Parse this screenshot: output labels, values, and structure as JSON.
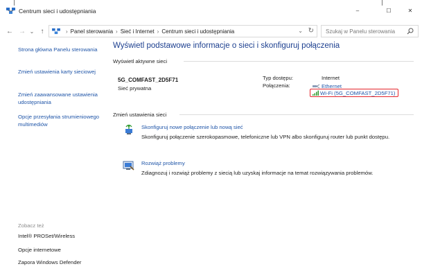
{
  "window": {
    "title": "Centrum sieci i udostępniania",
    "controls": {
      "minimize": "–",
      "maximize": "☐",
      "close": "✕"
    }
  },
  "nav": {
    "back": "←",
    "forward": "→",
    "recent": "⌄",
    "up": "↑",
    "breadcrumbs": [
      "Panel sterowania",
      "Sieć i Internet",
      "Centrum sieci i udostępniania"
    ],
    "separator": "›",
    "search_placeholder": "Szukaj w Panelu sterowania"
  },
  "sidebar": {
    "links": [
      "Strona główna Panelu sterowania",
      "Zmień ustawienia karty sieciowej",
      "Zmień zaawansowane ustawienia udostępniania",
      "Opcje przesyłania strumieniowego multimediów"
    ],
    "see_also_title": "Zobacz też",
    "see_also": [
      "Intel® PROSet/Wireless",
      "Opcje internetowe",
      "Zapora Windows Defender"
    ]
  },
  "main": {
    "title": "Wyświetl podstawowe informacje o sieci i skonfiguruj połączenia",
    "active_networks_label": "Wyświetl aktywne sieci",
    "network": {
      "name": "5G_COMFAST_2D5F71",
      "category": "Sieć prywatna",
      "access_type_label": "Typ dostępu:",
      "access_type_value": "Internet",
      "connections_label": "Połączenia:",
      "connection_ethernet": "Ethernet",
      "connection_wifi": "Wi-Fi (5G_COMFAST_2D5F71)"
    },
    "change_settings_label": "Zmień ustawienia sieci",
    "tasks": [
      {
        "icon": "network-setup-icon",
        "link": "Skonfiguruj nowe połączenie lub nową sieć",
        "description": "Skonfiguruj połączenie szerokopasmowe, telefoniczne lub VPN albo skonfiguruj router lub punkt dostępu."
      },
      {
        "icon": "troubleshoot-icon",
        "link": "Rozwiąż problemy",
        "description": "Zdiagnozuj i rozwiąż problemy z siecią lub uzyskaj informacje na temat rozwiązywania problemów."
      }
    ]
  },
  "colors": {
    "link": "#1f55a8",
    "title": "#1c3f8f",
    "highlight_border": "#e4242b",
    "wifi_bars": "#2e9a2e"
  }
}
